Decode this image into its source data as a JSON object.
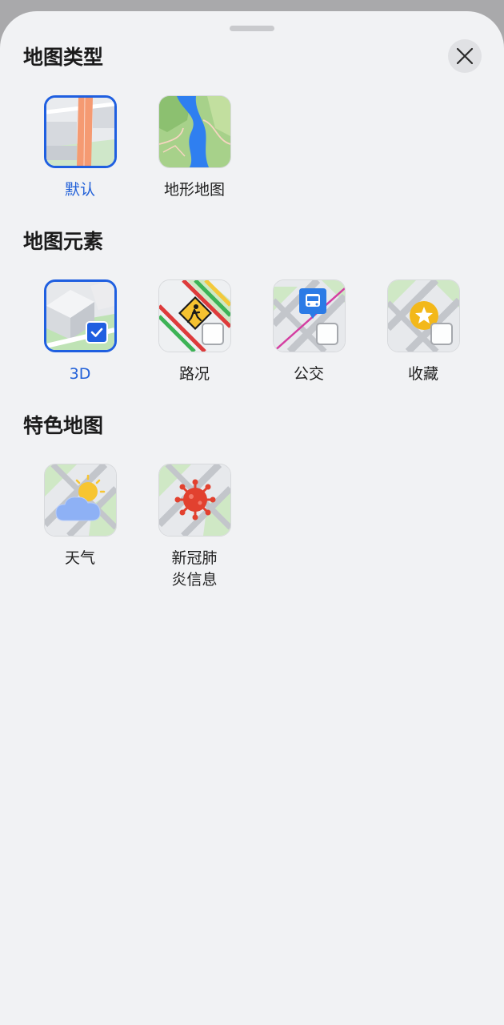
{
  "sheet": {
    "close_icon": "close-icon"
  },
  "sections": {
    "map_type": {
      "title": "地图类型",
      "items": [
        {
          "label": "默认",
          "selected": true,
          "icon": "default-map-thumb"
        },
        {
          "label": "地形地图",
          "selected": false,
          "icon": "terrain-map-thumb"
        }
      ]
    },
    "map_elements": {
      "title": "地图元素",
      "items": [
        {
          "label": "3D",
          "checked": true,
          "icon": "3d-buildings-thumb"
        },
        {
          "label": "路况",
          "checked": false,
          "icon": "traffic-roadwork-thumb"
        },
        {
          "label": "公交",
          "checked": false,
          "icon": "bus-stop-thumb"
        },
        {
          "label": "收藏",
          "checked": false,
          "icon": "star-favorite-thumb"
        }
      ]
    },
    "featured_maps": {
      "title": "特色地图",
      "items": [
        {
          "label": "天气",
          "icon": "weather-thumb"
        },
        {
          "label_line1": "新冠肺",
          "label_line2": "炎信息",
          "icon": "virus-thumb"
        }
      ]
    }
  },
  "colors": {
    "accent": "#1f5fe0",
    "sheet_bg": "#f1f2f4",
    "selected_label": "#2160d8"
  }
}
